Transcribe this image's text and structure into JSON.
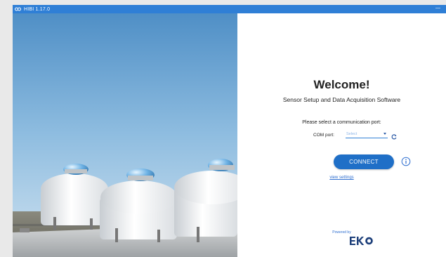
{
  "window": {
    "title": "HIBI 1.17.0",
    "minimize_label": "—"
  },
  "panel": {
    "welcome": "Welcome!",
    "subtitle": "Sensor Setup and Data Acquisition Software",
    "prompt": "Please select a communication port:",
    "com_label": "COM port:",
    "com_select_value": "Select",
    "connect_label": "CONNECT",
    "view_settings_label": "view settings",
    "powered_by": "Powered by",
    "brand": "EKO"
  },
  "colors": {
    "titlebar": "#2f7fd6",
    "accent": "#1f6fc7",
    "link": "#2f6fd0"
  }
}
